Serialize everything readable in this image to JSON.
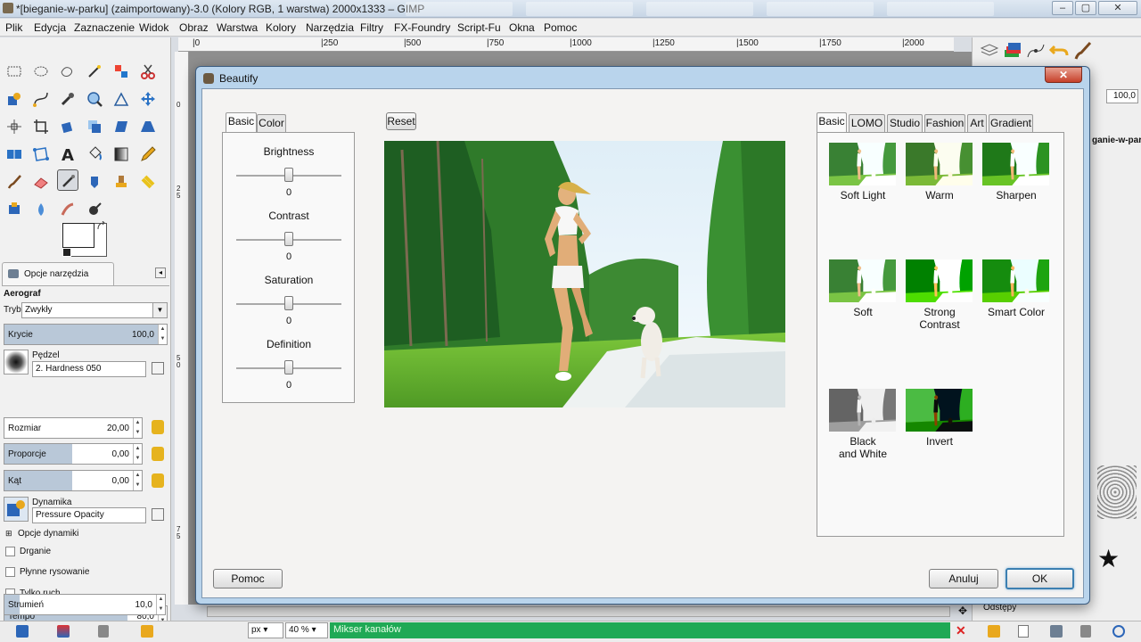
{
  "window": {
    "title": "*[bieganie-w-parku] (zaimportowany)-3.0 (Kolory RGB, 1 warstwa) 2000x1333 – GIMP",
    "min_btn": "–",
    "max_btn": "▢",
    "close_btn": "✕"
  },
  "menu": [
    "Plik",
    "Edycja",
    "Zaznaczenie",
    "Widok",
    "Obraz",
    "Warstwa",
    "Kolory",
    "Narzędzia",
    "Filtry",
    "FX-Foundry",
    "Script-Fu",
    "Okna",
    "Pomoc"
  ],
  "ruler": {
    "h_ticks": [
      "|0",
      "|250",
      "|500",
      "|750",
      "|1000",
      "|1250",
      "|1500",
      "|1750",
      "|2000"
    ],
    "v_ticks": [
      "0",
      "2 5",
      "5 0",
      "7 5"
    ]
  },
  "tool_options": {
    "tab_label": "Opcje narzędzia",
    "tool_name": "Aerograf",
    "mode_label": "Tryb:",
    "mode_value": "Zwykły",
    "opacity_label": "Krycie",
    "opacity_value": "100,0",
    "opacity_fraction": 1.0,
    "brush_label": "Pędzel",
    "brush_value": "2. Hardness 050",
    "size_label": "Rozmiar",
    "size_value": "20,00",
    "ratio_label": "Proporcje",
    "ratio_value": "0,00",
    "angle_label": "Kąt",
    "angle_value": "0,00",
    "dynamics_label": "Dynamika",
    "dynamics_value": "Pressure Opacity",
    "dynamics_options": "Opcje dynamiki",
    "jitter": "Drganie",
    "smooth": "Płynne rysowanie",
    "motion_only": "Tylko ruch",
    "rate_label": "Tempo",
    "rate_value": "80,0",
    "rate_fraction": 0.8,
    "flow_label": "Strumień",
    "flow_value": "10,0",
    "flow_fraction": 0.1
  },
  "right_dock": {
    "opacity_value": "100,0",
    "layer_name": "ganie-w-park",
    "history_label": "Odstępy"
  },
  "statusbar": {
    "unit": "px",
    "zoom": "40 %",
    "message": "Mikser kanałów"
  },
  "dialog": {
    "title": "Beautify",
    "close": "✕",
    "left_tabs": [
      "Basic",
      "Color"
    ],
    "reset": "Reset",
    "sliders": [
      {
        "name": "Brightness",
        "value": "0"
      },
      {
        "name": "Contrast",
        "value": "0"
      },
      {
        "name": "Saturation",
        "value": "0"
      },
      {
        "name": "Definition",
        "value": "0"
      }
    ],
    "right_tabs": [
      "Basic",
      "LOMO",
      "Studio",
      "Fashion",
      "Art",
      "Gradient"
    ],
    "presets": [
      {
        "label": "Soft Light",
        "style": "soft"
      },
      {
        "label": "Warm",
        "style": "warm"
      },
      {
        "label": "Sharpen",
        "style": "sharp"
      },
      {
        "label": "Soft",
        "style": "soft"
      },
      {
        "label": "Strong Contrast",
        "style": "strong"
      },
      {
        "label": "Smart Color",
        "style": "smart"
      },
      {
        "label": "Black and White",
        "style": "bw"
      },
      {
        "label": "Invert",
        "style": "invert"
      }
    ],
    "help_btn": "Pomoc",
    "cancel_btn": "Anuluj",
    "ok_btn": "OK"
  }
}
